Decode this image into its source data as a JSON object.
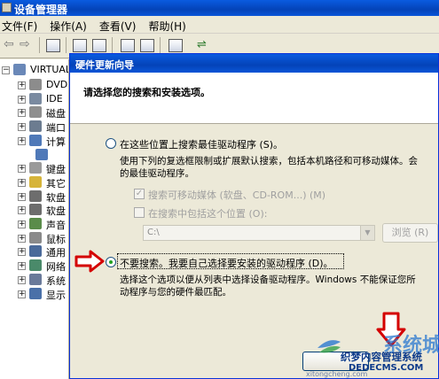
{
  "window": {
    "title": "设备管理器"
  },
  "menu": [
    "文件(F)",
    "操作(A)",
    "查看(V)",
    "帮助(H)"
  ],
  "tree": {
    "root": "VIRTUAL",
    "items": [
      {
        "label": "DVD",
        "icon": "dvd-drive-icon",
        "color": "#8c8c8c"
      },
      {
        "label": "IDE",
        "icon": "ide-controller-icon",
        "color": "#7a8aa0"
      },
      {
        "label": "磁盘",
        "icon": "disk-drive-icon",
        "color": "#8f8f8f"
      },
      {
        "label": "端口",
        "icon": "port-icon",
        "color": "#6c7c90"
      },
      {
        "label": "计算",
        "icon": "computer-icon",
        "color": "#4f79b8"
      },
      {
        "label": "",
        "icon": "computer-child-icon",
        "color": "#4f79b8"
      },
      {
        "label": "键盘",
        "icon": "keyboard-icon",
        "color": "#9a9a9a"
      },
      {
        "label": "其它",
        "icon": "unknown-device-icon",
        "color": "#d6b43a"
      },
      {
        "label": "软盘",
        "icon": "floppy-controller-icon",
        "color": "#6d6d6d"
      },
      {
        "label": "软盘",
        "icon": "floppy-drive-icon",
        "color": "#6d6d6d"
      },
      {
        "label": "声音",
        "icon": "sound-icon",
        "color": "#5a8c4a"
      },
      {
        "label": "鼠标",
        "icon": "mouse-icon",
        "color": "#8a8a8a"
      },
      {
        "label": "通用",
        "icon": "usb-icon",
        "color": "#4a6a9a"
      },
      {
        "label": "网络",
        "icon": "network-icon",
        "color": "#4a8a6a"
      },
      {
        "label": "系统",
        "icon": "system-icon",
        "color": "#6a7a9a"
      },
      {
        "label": "显示",
        "icon": "display-icon",
        "color": "#4a70a8"
      }
    ]
  },
  "wizard": {
    "title": "硬件更新向导",
    "heading": "请选择您的搜索和安装选项。",
    "option_search": {
      "label": "在这些位置上搜索最佳驱动程序 (S)。",
      "desc": [
        "使用下列的复选框限制或扩展默认搜索，包括本机路径和可移动媒体。会",
        "的最佳驱动程序。"
      ]
    },
    "chk_removable": "搜索可移动媒体 (软盘、CD-ROM...) (M)",
    "chk_location": "在搜索中包括这个位置 (O):",
    "path_value": "C:\\",
    "browse": "浏览 (R)",
    "option_manual": {
      "label": "不要搜索。我要自己选择要安装的驱动程序 (D)。",
      "desc": [
        "选择这个选项以便从列表中选择设备驱动程序。Windows 不能保证您所",
        "动程序与您的硬件最匹配。"
      ]
    },
    "accent": "#d40000"
  },
  "watermark": {
    "brand": "系统城",
    "line1": "织梦内容管理系统",
    "line2": "DEDECMS.COM",
    "url": "xitongcheng.com"
  }
}
